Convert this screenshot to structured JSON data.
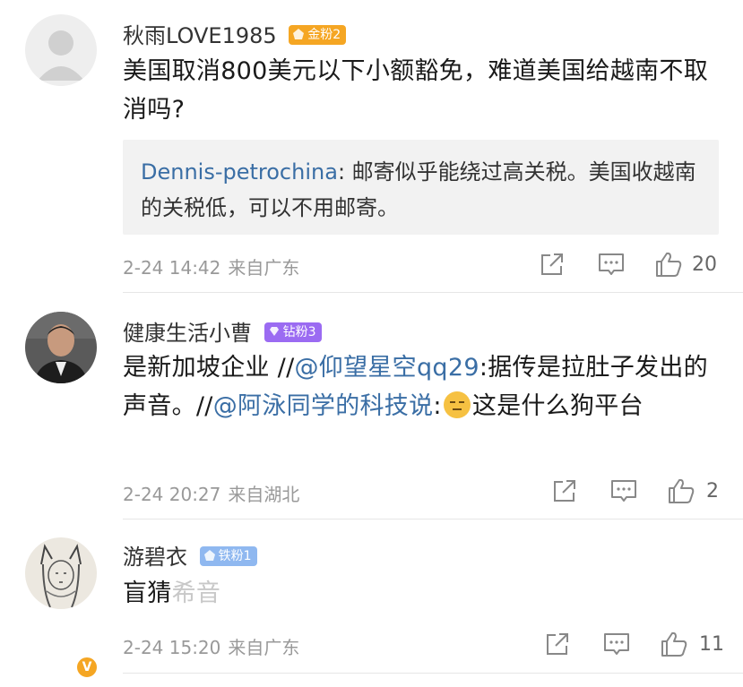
{
  "comments": [
    {
      "username": "秋雨LOVE1985",
      "badge": "金粉2",
      "badge_color": "#f5a623",
      "avatar": "default-avatar",
      "text": "美国取消800美元以下小额豁免，难道美国给越南不取消吗?",
      "reply_quote": {
        "name": "Dennis-petrochina",
        "text": "邮寄似乎能绕过高关税。美国收越南的关税低，可以不用邮寄。"
      },
      "date": "2-24 14:42",
      "location": "来自广东",
      "likes": "20"
    },
    {
      "username": "健康生活小曹",
      "badge": "钻粉3",
      "badge_color": "#9b6bf2",
      "avatar": "photo-avatar",
      "verified": "V",
      "text_parts": {
        "a": "是新加坡企业 //",
        "b": "@仰望星空qq29",
        "c": ":据传是拉肚子发出的声音。//",
        "d": "@阿泳同学的科技说",
        "e": ":",
        "f": "这是什么狗平台"
      },
      "date": "2-24 20:27",
      "location": "来自湖北",
      "likes": "2"
    },
    {
      "username": "游碧衣",
      "badge": "铁粉1",
      "badge_color": "#8fb8f0",
      "avatar": "sketch-avatar",
      "text": "盲猜",
      "text_faded": "希音",
      "date": "2-24 15:20",
      "location": "来自广东",
      "likes": "11"
    }
  ],
  "icons": [
    "share-icon",
    "comment-icon",
    "like-icon"
  ]
}
